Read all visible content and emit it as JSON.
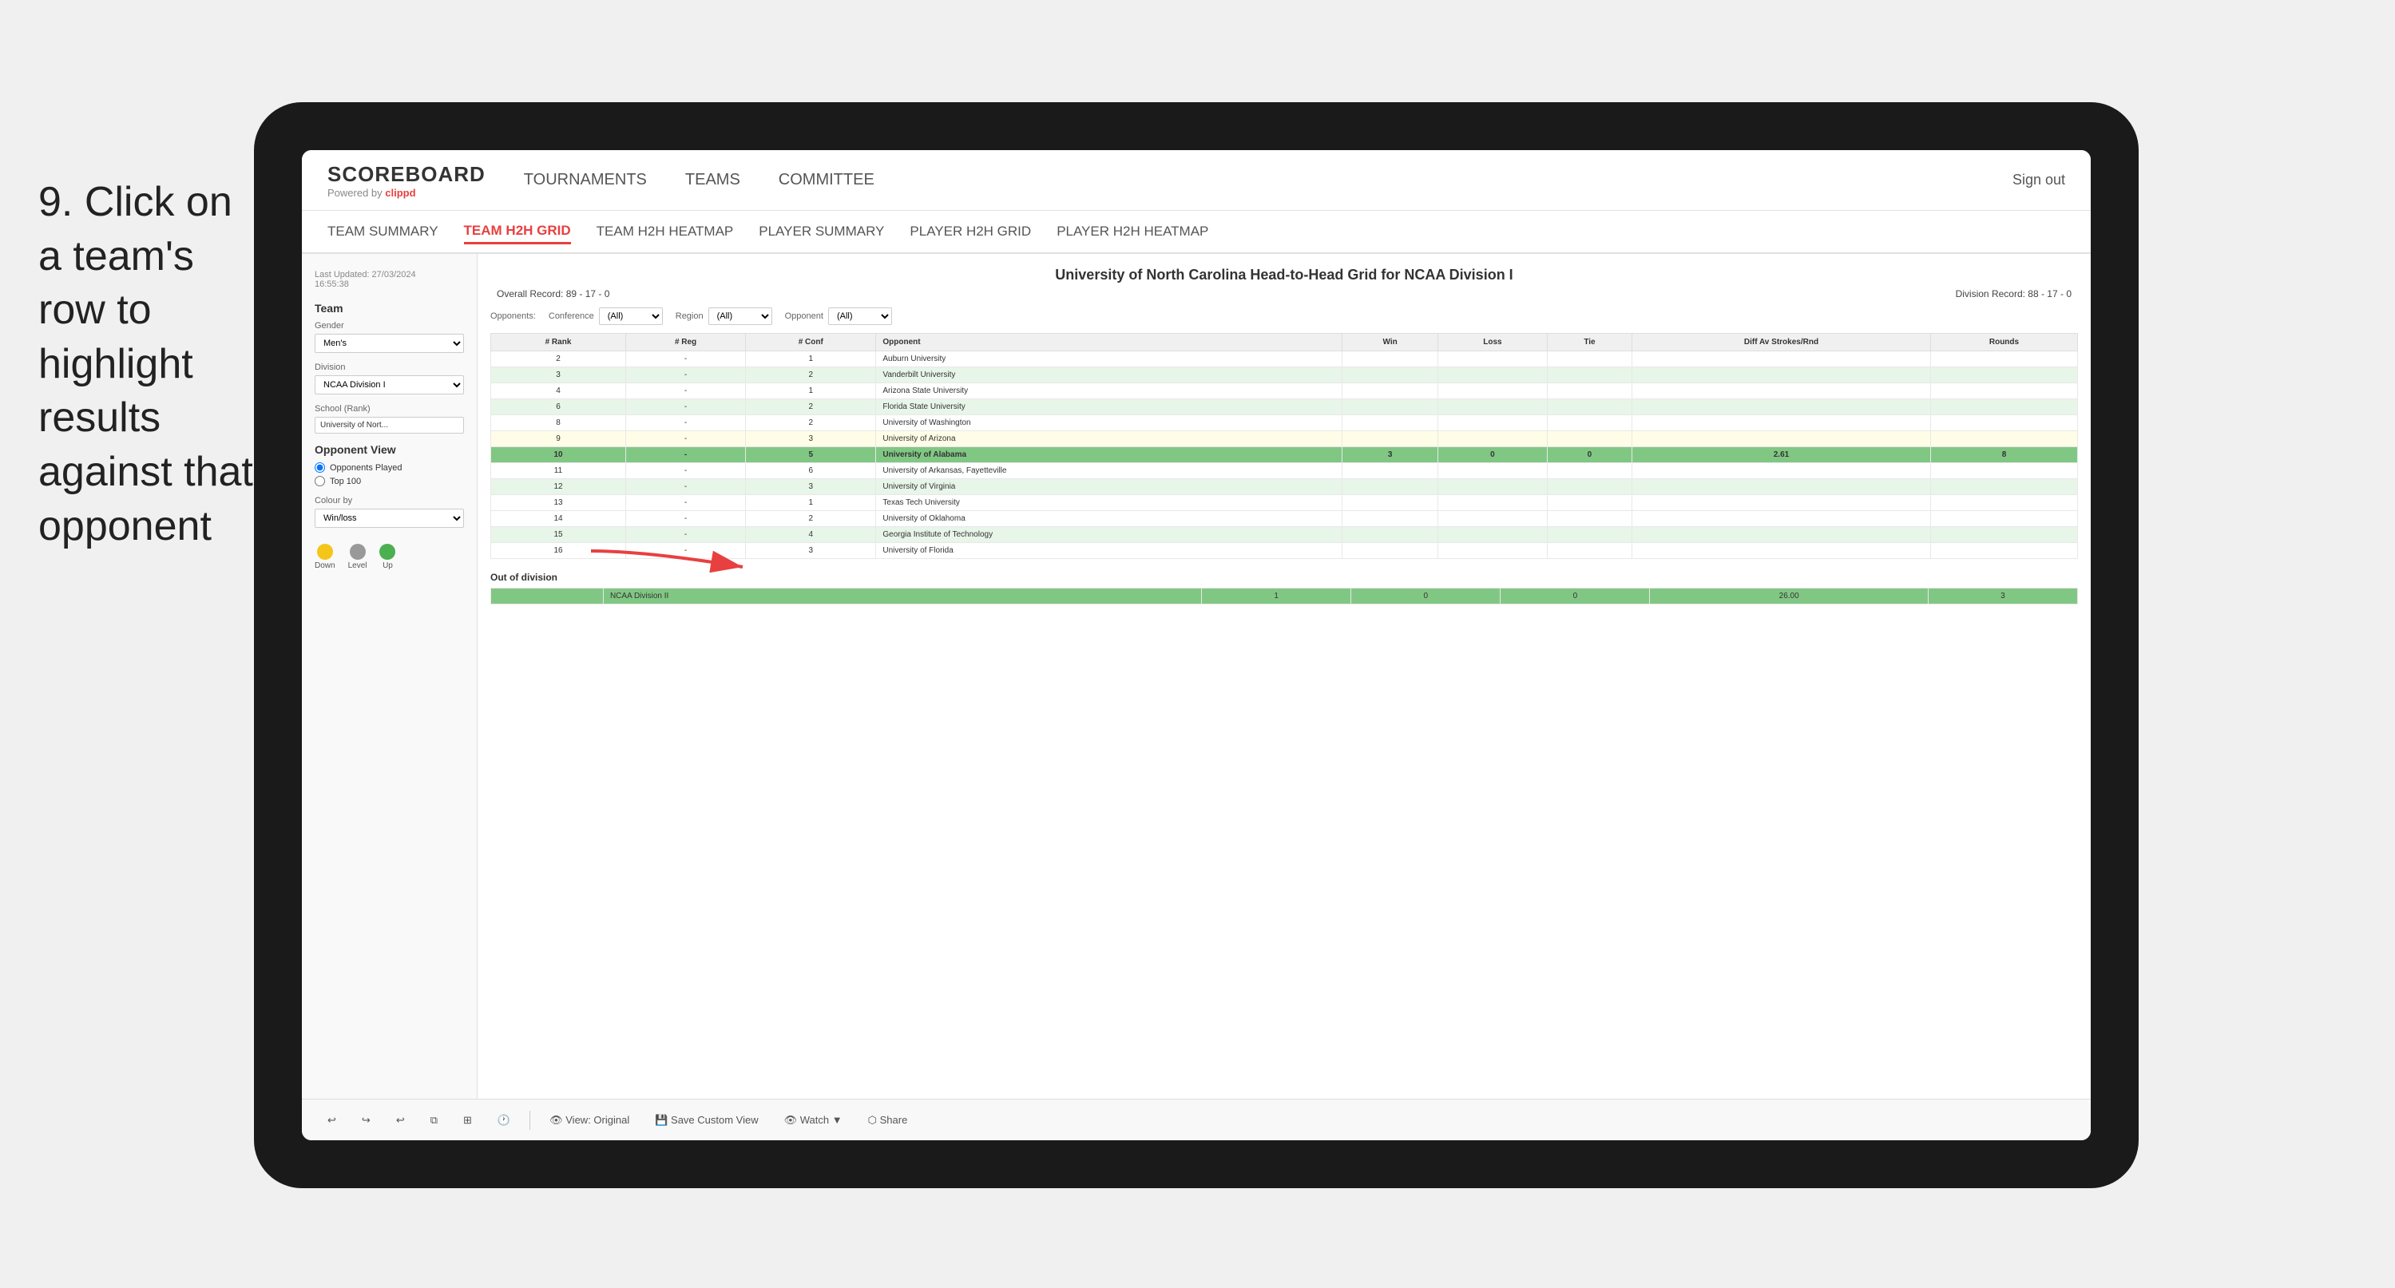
{
  "instruction": {
    "step": "9.",
    "text": "Click on a team's row to highlight results against that opponent"
  },
  "nav": {
    "logo": "SCOREBOARD",
    "logo_sub": "Powered by",
    "logo_brand": "clippd",
    "items": [
      "TOURNAMENTS",
      "TEAMS",
      "COMMITTEE"
    ],
    "sign_in": "Sign out"
  },
  "sub_nav": {
    "items": [
      "TEAM SUMMARY",
      "TEAM H2H GRID",
      "TEAM H2H HEATMAP",
      "PLAYER SUMMARY",
      "PLAYER H2H GRID",
      "PLAYER H2H HEATMAP"
    ],
    "active": "TEAM H2H GRID"
  },
  "sidebar": {
    "last_updated_label": "Last Updated: 27/03/2024",
    "time": "16:55:38",
    "team_label": "Team",
    "gender_label": "Gender",
    "gender_value": "Men's",
    "division_label": "Division",
    "division_value": "NCAA Division I",
    "school_label": "School (Rank)",
    "school_value": "University of Nort...",
    "opponent_view_label": "Opponent View",
    "radio1": "Opponents Played",
    "radio2": "Top 100",
    "colour_by_label": "Colour by",
    "colour_by_value": "Win/loss",
    "legend": {
      "down_label": "Down",
      "level_label": "Level",
      "up_label": "Up",
      "down_color": "#f5c518",
      "level_color": "#999",
      "up_color": "#4caf50"
    }
  },
  "grid": {
    "title": "University of North Carolina Head-to-Head Grid for NCAA Division I",
    "overall_record": "Overall Record: 89 - 17 - 0",
    "division_record": "Division Record: 88 - 17 - 0",
    "filter_opponents_label": "Opponents:",
    "filter_conference_label": "Conference",
    "filter_conference_value": "(All)",
    "filter_region_label": "Region",
    "filter_region_value": "(All)",
    "filter_opponent_label": "Opponent",
    "filter_opponent_value": "(All)",
    "columns": [
      "# Rank",
      "# Reg",
      "# Conf",
      "Opponent",
      "Win",
      "Loss",
      "Tie",
      "Diff Av Strokes/Rnd",
      "Rounds"
    ],
    "rows": [
      {
        "rank": "2",
        "reg": "-",
        "conf": "1",
        "opponent": "Auburn University",
        "win": "",
        "loss": "",
        "tie": "",
        "diff": "",
        "rounds": "",
        "style": "normal"
      },
      {
        "rank": "3",
        "reg": "-",
        "conf": "2",
        "opponent": "Vanderbilt University",
        "win": "",
        "loss": "",
        "tie": "",
        "diff": "",
        "rounds": "",
        "style": "light-green"
      },
      {
        "rank": "4",
        "reg": "-",
        "conf": "1",
        "opponent": "Arizona State University",
        "win": "",
        "loss": "",
        "tie": "",
        "diff": "",
        "rounds": "",
        "style": "normal"
      },
      {
        "rank": "6",
        "reg": "-",
        "conf": "2",
        "opponent": "Florida State University",
        "win": "",
        "loss": "",
        "tie": "",
        "diff": "",
        "rounds": "",
        "style": "light-green"
      },
      {
        "rank": "8",
        "reg": "-",
        "conf": "2",
        "opponent": "University of Washington",
        "win": "",
        "loss": "",
        "tie": "",
        "diff": "",
        "rounds": "",
        "style": "normal"
      },
      {
        "rank": "9",
        "reg": "-",
        "conf": "3",
        "opponent": "University of Arizona",
        "win": "",
        "loss": "",
        "tie": "",
        "diff": "",
        "rounds": "",
        "style": "light-yellow"
      },
      {
        "rank": "10",
        "reg": "-",
        "conf": "5",
        "opponent": "University of Alabama",
        "win": "3",
        "loss": "0",
        "tie": "0",
        "diff": "2.61",
        "rounds": "8",
        "style": "selected"
      },
      {
        "rank": "11",
        "reg": "-",
        "conf": "6",
        "opponent": "University of Arkansas, Fayetteville",
        "win": "",
        "loss": "",
        "tie": "",
        "diff": "",
        "rounds": "",
        "style": "normal"
      },
      {
        "rank": "12",
        "reg": "-",
        "conf": "3",
        "opponent": "University of Virginia",
        "win": "",
        "loss": "",
        "tie": "",
        "diff": "",
        "rounds": "",
        "style": "light-green"
      },
      {
        "rank": "13",
        "reg": "-",
        "conf": "1",
        "opponent": "Texas Tech University",
        "win": "",
        "loss": "",
        "tie": "",
        "diff": "",
        "rounds": "",
        "style": "normal"
      },
      {
        "rank": "14",
        "reg": "-",
        "conf": "2",
        "opponent": "University of Oklahoma",
        "win": "",
        "loss": "",
        "tie": "",
        "diff": "",
        "rounds": "",
        "style": "normal"
      },
      {
        "rank": "15",
        "reg": "-",
        "conf": "4",
        "opponent": "Georgia Institute of Technology",
        "win": "",
        "loss": "",
        "tie": "",
        "diff": "",
        "rounds": "",
        "style": "light-green"
      },
      {
        "rank": "16",
        "reg": "-",
        "conf": "3",
        "opponent": "University of Florida",
        "win": "",
        "loss": "",
        "tie": "",
        "diff": "",
        "rounds": "",
        "style": "normal"
      }
    ],
    "out_of_division_label": "Out of division",
    "out_of_division_row": {
      "label": "NCAA Division II",
      "win": "1",
      "loss": "0",
      "tie": "0",
      "diff": "26.00",
      "rounds": "3",
      "style": "out-of-div"
    }
  },
  "toolbar": {
    "view_label": "View: Original",
    "save_label": "Save Custom View",
    "watch_label": "Watch",
    "share_label": "Share"
  }
}
